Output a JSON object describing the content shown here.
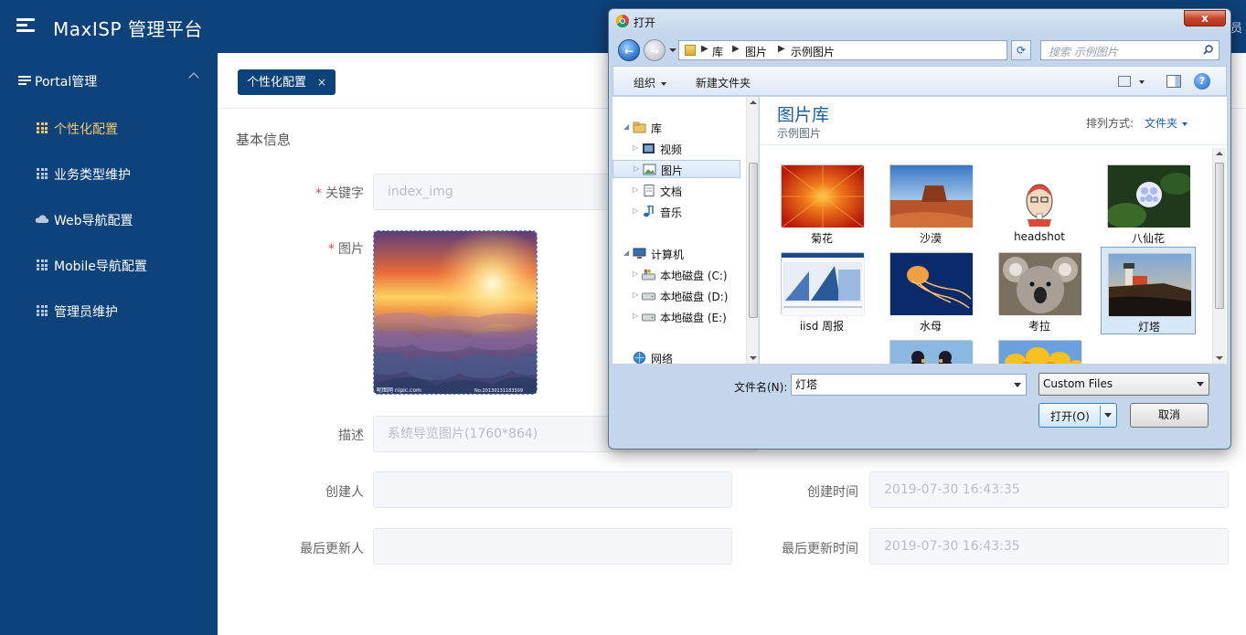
{
  "app": {
    "title": "MaxISP 管理平台",
    "user_fragment": "员"
  },
  "sidebar": {
    "group_label": "Portal管理",
    "items": [
      {
        "label": "个性化配置",
        "active": true,
        "icon": "grid-icon"
      },
      {
        "label": "业务类型维护",
        "active": false,
        "icon": "grid-icon"
      },
      {
        "label": "Web导航配置",
        "active": false,
        "icon": "cloud-icon"
      },
      {
        "label": "Mobile导航配置",
        "active": false,
        "icon": "grid-icon"
      },
      {
        "label": "管理员维护",
        "active": false,
        "icon": "grid-icon"
      }
    ]
  },
  "tabs": [
    {
      "label": "个性化配置",
      "close": "×"
    }
  ],
  "form": {
    "section_title": "基本信息",
    "required_mark": "*",
    "keyword_label": "关键字",
    "keyword_value": "index_img",
    "image_label": "图片",
    "image_watermark_left": "昵图网 nipic.com",
    "image_watermark_right": "No:20130131183509",
    "desc_label": "描述",
    "desc_value": "系统导览图片(1760*864)",
    "creator_label": "创建人",
    "creator_value": "",
    "created_time_label": "创建时间",
    "created_time_value": "2019-07-30 16:43:35",
    "updater_label": "最后更新人",
    "updater_value": "",
    "updated_time_label": "最后更新时间",
    "updated_time_value": "2019-07-30 16:43:35"
  },
  "dialog": {
    "title": "打开",
    "close": "x",
    "breadcrumb": [
      "库",
      "图片",
      "示例图片"
    ],
    "search_placeholder": "搜索 示例图片",
    "toolbar": {
      "organize": "组织",
      "new_folder": "新建文件夹",
      "help": "?"
    },
    "nav_pane": [
      {
        "label": "库",
        "expander": "◢",
        "icon": "library-icon"
      },
      {
        "label": "视频",
        "expander": "▷",
        "icon": "video-icon"
      },
      {
        "label": "图片",
        "expander": "▷",
        "icon": "picture-icon",
        "selected": true
      },
      {
        "label": "文档",
        "expander": "▷",
        "icon": "document-icon"
      },
      {
        "label": "音乐",
        "expander": "▷",
        "icon": "music-icon"
      },
      {
        "label": "计算机",
        "expander": "◢",
        "icon": "computer-icon"
      },
      {
        "label": "本地磁盘 (C:)",
        "expander": "▷",
        "icon": "windows-drive-icon"
      },
      {
        "label": "本地磁盘 (D:)",
        "expander": "▷",
        "icon": "drive-icon"
      },
      {
        "label": "本地磁盘 (E:)",
        "expander": "▷",
        "icon": "drive-icon"
      },
      {
        "label": "网络",
        "expander": "",
        "icon": "network-icon"
      }
    ],
    "library_title": "图片库",
    "library_subtitle": "示例图片",
    "sort_label": "排列方式:",
    "sort_value": "文件夹",
    "files": [
      {
        "name": "菊花",
        "selected": false
      },
      {
        "name": "沙漠",
        "selected": false
      },
      {
        "name": "headshot",
        "selected": false
      },
      {
        "name": "八仙花",
        "selected": false
      },
      {
        "name": "iisd 周报",
        "selected": false
      },
      {
        "name": "水母",
        "selected": false
      },
      {
        "name": "考拉",
        "selected": false
      },
      {
        "name": "灯塔",
        "selected": true
      },
      {
        "name": "",
        "selected": false
      },
      {
        "name": "",
        "selected": false
      }
    ],
    "filename_label": "文件名(N):",
    "filename_value": "灯塔",
    "filetype_value": "Custom Files",
    "open_label": "打开(O)",
    "cancel_label": "取消",
    "colors": {
      "accent": "#0e427a",
      "active_menu": "#f3c96b",
      "library_title": "#1e5f9e"
    }
  }
}
